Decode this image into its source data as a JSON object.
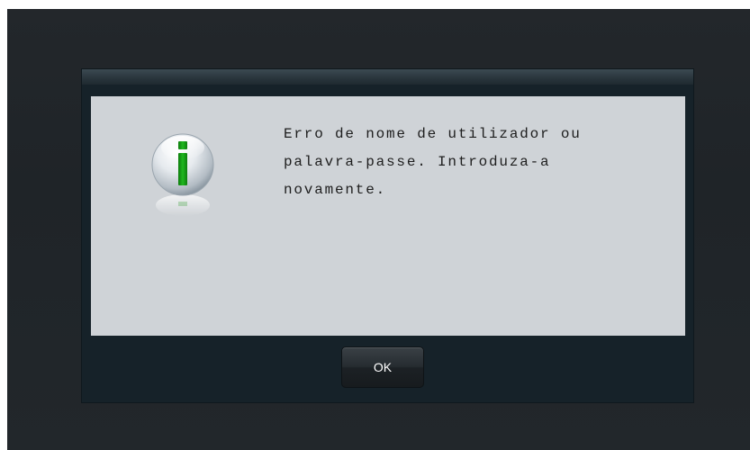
{
  "dialog": {
    "icon": "info-icon",
    "message": "Erro de nome de utilizador ou\npalavra-passe. Introduza-a\nnovamente.",
    "ok_label": "OK"
  },
  "colors": {
    "background": "#22272b",
    "dialog_frame": "#162229",
    "content_panel": "#cfd3d7",
    "icon_accent": "#16a316"
  }
}
